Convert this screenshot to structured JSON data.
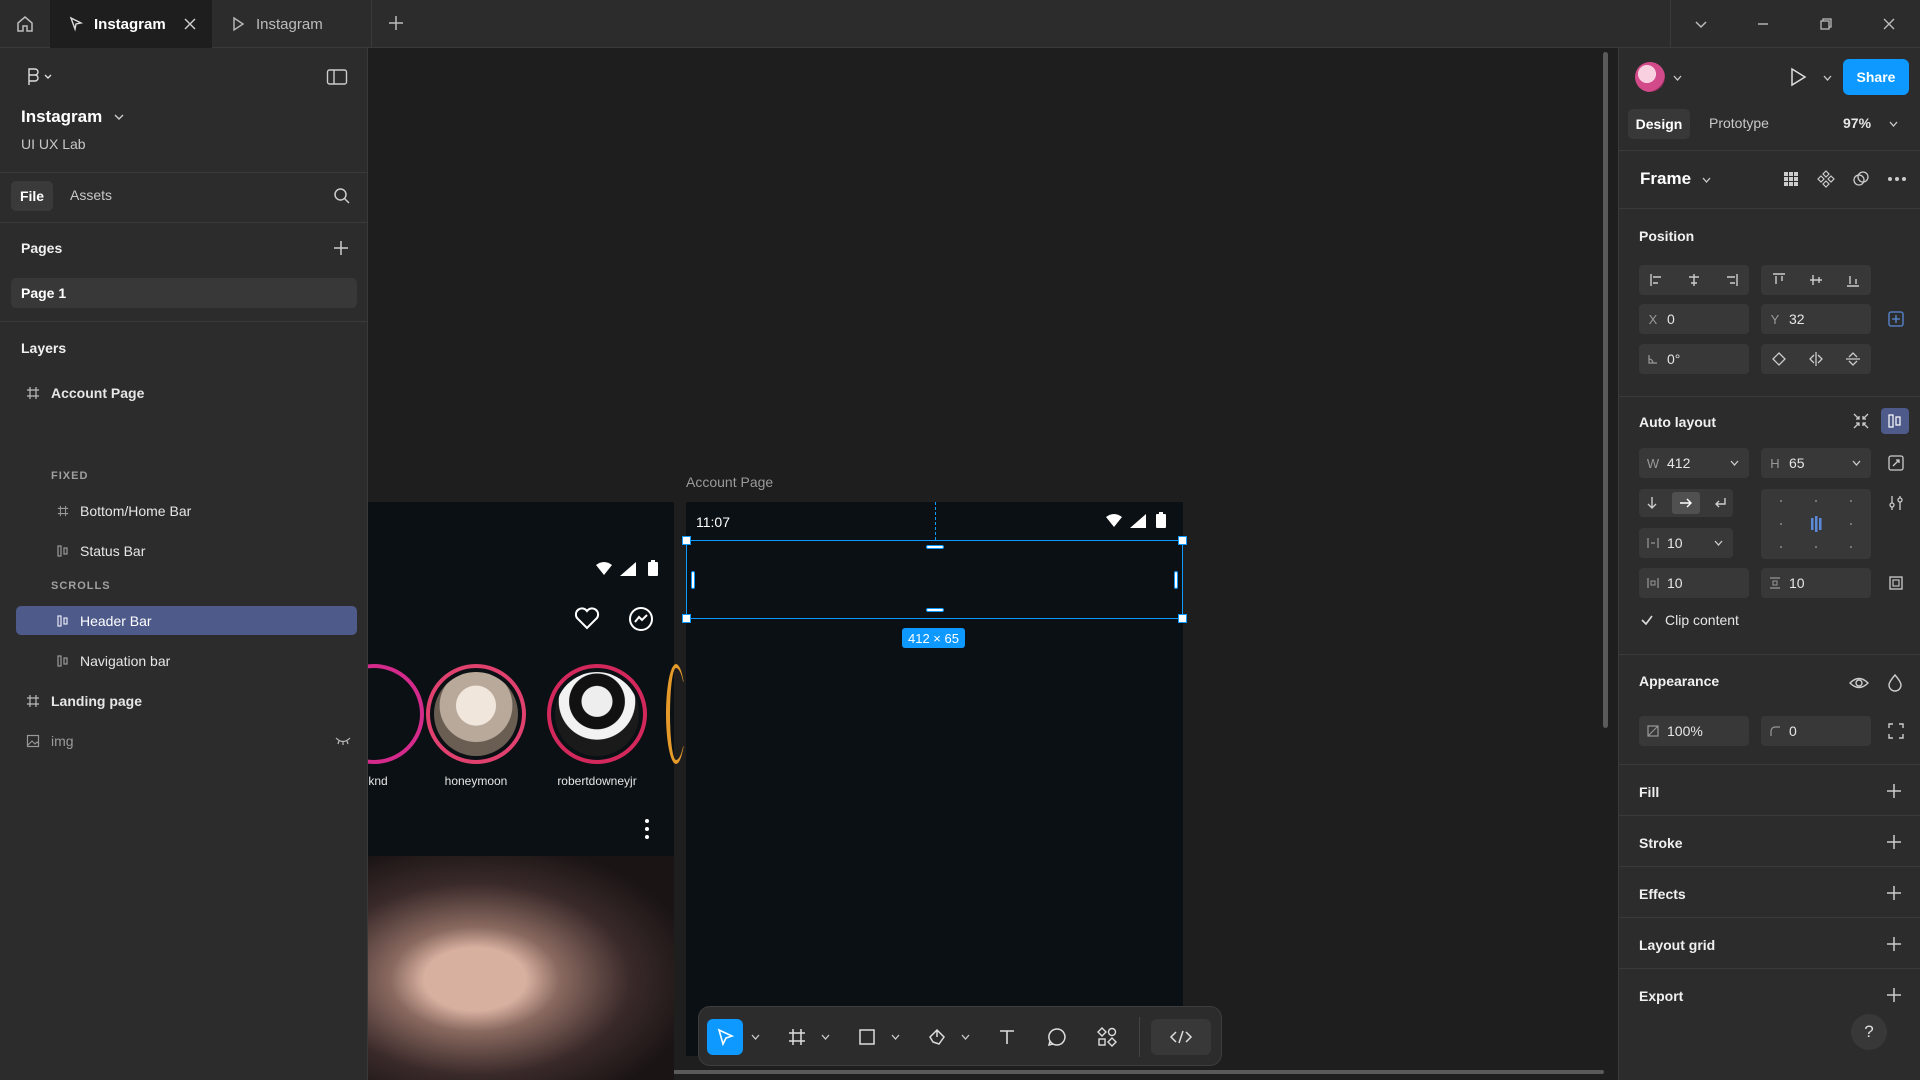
{
  "tabs": [
    {
      "label": "Instagram",
      "active": true
    },
    {
      "label": "Instagram",
      "active": false
    }
  ],
  "left_panel": {
    "file_name": "Instagram",
    "team": "UI UX Lab",
    "tab_file": "File",
    "tab_assets": "Assets",
    "pages_header": "Pages",
    "page_item": "Page 1",
    "layers_header": "Layers",
    "layers": [
      {
        "label": "Account Page",
        "type": "frame"
      },
      {
        "label": "FIXED",
        "type": "section"
      },
      {
        "label": "Bottom/Home Bar",
        "type": "frame"
      },
      {
        "label": "Status Bar",
        "type": "autolayout"
      },
      {
        "label": "SCROLLS",
        "type": "section"
      },
      {
        "label": "Header Bar",
        "type": "autolayout",
        "selected": true
      },
      {
        "label": "Navigation bar",
        "type": "autolayout"
      },
      {
        "label": "Landing page",
        "type": "frame"
      },
      {
        "label": "img",
        "type": "image",
        "hidden": true
      }
    ]
  },
  "canvas": {
    "frame_label": "Account Page",
    "status_time": "11:07",
    "selection_size": "412 × 65",
    "stories": [
      "knd",
      "honeymoon",
      "robertdowneyjr"
    ]
  },
  "right_panel": {
    "share_label": "Share",
    "tab_design": "Design",
    "tab_prototype": "Prototype",
    "zoom": "97%",
    "frame_label": "Frame",
    "position_header": "Position",
    "x_label": "X",
    "x_value": "0",
    "y_label": "Y",
    "y_value": "32",
    "rotation": "0°",
    "auto_layout_header": "Auto layout",
    "w_label": "W",
    "w_value": "412",
    "h_label": "H",
    "h_value": "65",
    "gap": "10",
    "padding_h": "10",
    "padding_v": "10",
    "clip_content": "Clip content",
    "appearance_header": "Appearance",
    "opacity": "100%",
    "radius": "0",
    "fill": "Fill",
    "stroke": "Stroke",
    "effects": "Effects",
    "layout_grid": "Layout grid",
    "export": "Export",
    "help": "?"
  },
  "colors": {
    "accent": "#0d99ff",
    "panel": "#2c2c2c",
    "canvas": "#1e1e1e",
    "frame": "#0b1014"
  },
  "icons": [
    "home-icon",
    "prototype-play-icon",
    "close-icon",
    "plus-icon",
    "chevron-down-icon",
    "minimize-icon",
    "restore-icon",
    "figma-menu-icon",
    "sidebar-toggle-icon",
    "search-icon",
    "frame-icon",
    "autolayout-icon",
    "image-icon",
    "eye-hidden-icon",
    "heart-icon",
    "messenger-icon",
    "wifi-icon",
    "signal-icon",
    "battery-icon",
    "move-tool-icon",
    "frame-tool-icon",
    "rectangle-tool-icon",
    "pen-tool-icon",
    "text-tool-icon",
    "comment-tool-icon",
    "components-icon",
    "dev-mode-icon",
    "avatar",
    "eye-icon",
    "drop-icon",
    "check-icon"
  ]
}
